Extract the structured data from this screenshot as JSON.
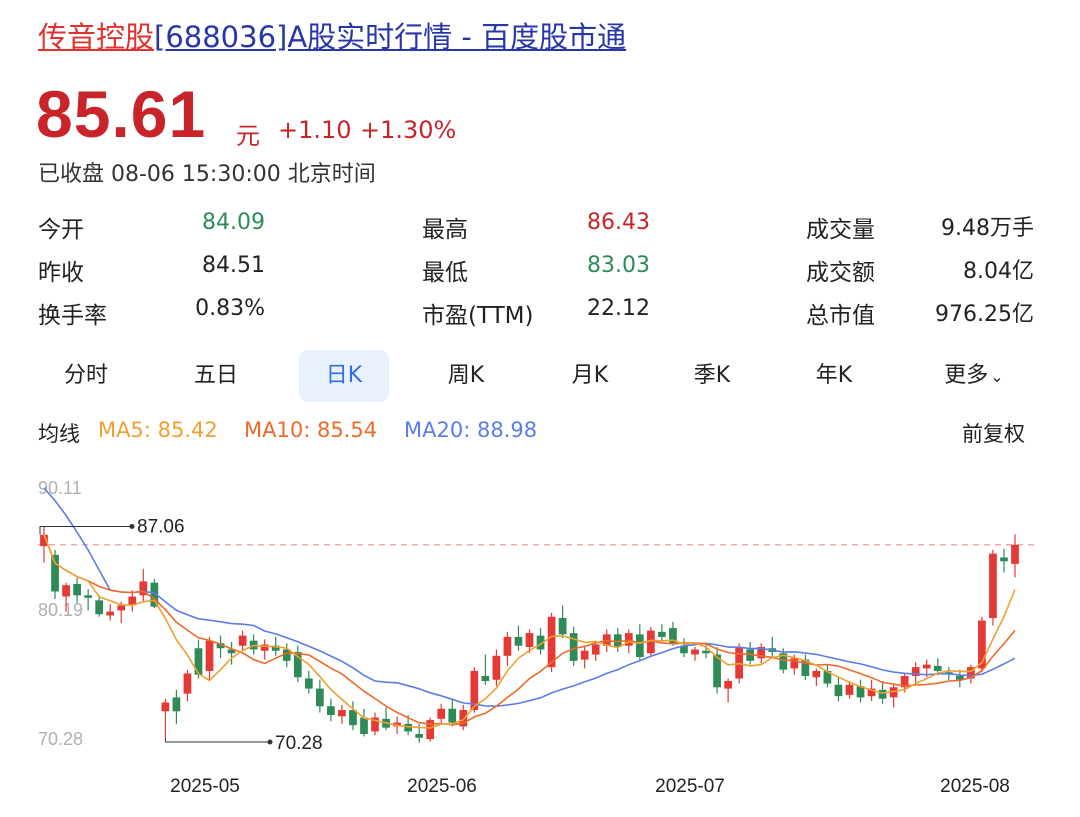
{
  "header": {
    "stock_name": "传音控股",
    "title_rest": "[688036]A股实时行情 - 百度股市通"
  },
  "quote": {
    "price": "85.61",
    "unit": "元",
    "change": "+1.10",
    "change_pct": "+1.30%",
    "status": "已收盘 08-06 15:30:00 北京时间"
  },
  "stats": [
    {
      "label": "今开",
      "value": "84.09",
      "color": "#2e8b57"
    },
    {
      "label": "昨收",
      "value": "84.51",
      "color": "#222222"
    },
    {
      "label": "换手率",
      "value": "0.83%",
      "color": "#222222"
    },
    {
      "label": "最高",
      "value": "86.43",
      "color": "#c8242a"
    },
    {
      "label": "最低",
      "value": "83.03",
      "color": "#2e8b57"
    },
    {
      "label": "市盈(TTM)",
      "value": "22.12",
      "color": "#222222"
    },
    {
      "label": "成交量",
      "value": "9.48万手",
      "color": "#222222"
    },
    {
      "label": "成交额",
      "value": "8.04亿",
      "color": "#222222"
    },
    {
      "label": "总市值",
      "value": "976.25亿",
      "color": "#222222"
    }
  ],
  "tabs": [
    "分时",
    "五日",
    "日K",
    "周K",
    "月K",
    "季K",
    "年K",
    "更多"
  ],
  "active_tab": "日K",
  "ma": {
    "label": "均线",
    "ma5": "MA5: 85.42",
    "ma10": "MA10: 85.54",
    "ma20": "MA20: 88.98",
    "adjust": "前复权",
    "colors": {
      "ma5": "#f0a030",
      "ma10": "#ee6a2a",
      "ma20": "#5b7de8"
    }
  },
  "chart_data": {
    "type": "candlestick",
    "y_ticks": [
      "90.11",
      "80.19",
      "70.28"
    ],
    "ylim": [
      70.28,
      90.11
    ],
    "x_ticks": [
      "2025-05",
      "2025-06",
      "2025-07",
      "2025-08"
    ],
    "annotations": {
      "high": "87.06",
      "low": "70.28"
    },
    "reference_price": 85.61,
    "colors": {
      "up": "#e53935",
      "down": "#2e8b57"
    },
    "candles": [
      [
        85.5,
        87.06,
        84.2,
        86.4
      ],
      [
        84.8,
        85.2,
        81.3,
        81.9
      ],
      [
        81.5,
        82.6,
        80.3,
        82.4
      ],
      [
        82.5,
        83.0,
        81.0,
        81.6
      ],
      [
        81.6,
        82.1,
        80.4,
        81.4
      ],
      [
        81.2,
        81.6,
        79.9,
        80.1
      ],
      [
        80.0,
        80.9,
        79.6,
        80.3
      ],
      [
        80.4,
        81.1,
        79.4,
        80.8
      ],
      [
        80.8,
        82.0,
        80.3,
        81.5
      ],
      [
        81.6,
        83.7,
        81.1,
        82.7
      ],
      [
        82.6,
        82.9,
        80.6,
        80.7
      ],
      [
        72.4,
        73.4,
        70.28,
        73.1
      ],
      [
        73.5,
        74.1,
        71.4,
        72.4
      ],
      [
        73.8,
        75.7,
        73.2,
        75.4
      ],
      [
        77.4,
        78.1,
        75.0,
        75.3
      ],
      [
        75.6,
        78.3,
        74.9,
        78.0
      ],
      [
        77.8,
        78.4,
        76.6,
        77.4
      ],
      [
        77.3,
        77.9,
        76.1,
        77.0
      ],
      [
        77.6,
        78.8,
        77.2,
        78.4
      ],
      [
        78.0,
        78.5,
        76.9,
        77.3
      ],
      [
        77.2,
        78.1,
        76.5,
        77.7
      ],
      [
        77.6,
        78.3,
        76.8,
        77.2
      ],
      [
        77.3,
        77.8,
        75.9,
        76.4
      ],
      [
        77.1,
        77.6,
        74.7,
        75.1
      ],
      [
        75.0,
        75.6,
        73.8,
        74.2
      ],
      [
        74.2,
        74.9,
        72.3,
        72.8
      ],
      [
        72.8,
        73.4,
        71.6,
        72.1
      ],
      [
        72.0,
        72.9,
        71.4,
        72.5
      ],
      [
        72.5,
        73.2,
        70.9,
        71.3
      ],
      [
        71.9,
        72.6,
        70.4,
        70.6
      ],
      [
        70.8,
        72.3,
        70.5,
        71.9
      ],
      [
        71.8,
        72.7,
        70.9,
        71.1
      ],
      [
        71.2,
        72.0,
        70.6,
        71.5
      ],
      [
        71.4,
        72.1,
        70.5,
        70.8
      ],
      [
        70.6,
        71.4,
        69.9,
        70.3
      ],
      [
        70.2,
        71.9,
        70.0,
        71.7
      ],
      [
        71.8,
        73.0,
        71.5,
        72.6
      ],
      [
        72.6,
        73.4,
        71.2,
        71.5
      ],
      [
        71.2,
        72.9,
        70.9,
        72.5
      ],
      [
        72.5,
        75.9,
        72.3,
        75.6
      ],
      [
        75.2,
        76.9,
        74.5,
        74.8
      ],
      [
        74.9,
        77.3,
        74.4,
        76.8
      ],
      [
        76.8,
        78.7,
        76.0,
        78.3
      ],
      [
        78.3,
        79.2,
        77.2,
        77.6
      ],
      [
        77.5,
        78.9,
        77.0,
        78.6
      ],
      [
        78.4,
        79.0,
        76.9,
        77.3
      ],
      [
        75.9,
        80.2,
        75.5,
        79.9
      ],
      [
        79.8,
        80.8,
        78.2,
        78.5
      ],
      [
        78.6,
        79.1,
        76.0,
        76.4
      ],
      [
        76.5,
        77.6,
        75.8,
        77.2
      ],
      [
        76.9,
        78.0,
        76.4,
        77.7
      ],
      [
        77.6,
        78.9,
        77.1,
        78.5
      ],
      [
        78.5,
        79.0,
        77.1,
        77.5
      ],
      [
        77.6,
        78.9,
        77.0,
        78.6
      ],
      [
        78.5,
        79.3,
        76.4,
        76.7
      ],
      [
        77.0,
        79.1,
        76.8,
        78.8
      ],
      [
        78.7,
        79.3,
        78.0,
        78.3
      ],
      [
        79.0,
        79.5,
        77.6,
        77.8
      ],
      [
        77.6,
        78.2,
        76.7,
        77.0
      ],
      [
        76.9,
        77.5,
        76.4,
        77.3
      ],
      [
        77.2,
        77.8,
        76.6,
        77.0
      ],
      [
        76.9,
        77.5,
        73.8,
        74.3
      ],
      [
        74.2,
        75.0,
        73.1,
        74.8
      ],
      [
        75.0,
        77.8,
        74.6,
        77.5
      ],
      [
        77.3,
        77.9,
        76.1,
        76.4
      ],
      [
        76.6,
        77.8,
        76.2,
        77.5
      ],
      [
        77.4,
        78.3,
        76.7,
        77.1
      ],
      [
        77.0,
        77.4,
        75.4,
        75.7
      ],
      [
        75.8,
        76.9,
        75.3,
        76.6
      ],
      [
        76.5,
        76.9,
        74.9,
        75.2
      ],
      [
        75.1,
        75.8,
        74.4,
        75.6
      ],
      [
        75.6,
        76.1,
        74.3,
        74.6
      ],
      [
        74.5,
        75.1,
        73.2,
        73.6
      ],
      [
        73.7,
        74.8,
        73.4,
        74.5
      ],
      [
        74.4,
        74.9,
        73.1,
        73.5
      ],
      [
        73.6,
        74.9,
        73.2,
        74.2
      ],
      [
        74.1,
        74.8,
        73.0,
        73.4
      ],
      [
        73.5,
        74.5,
        72.7,
        74.3
      ],
      [
        74.3,
        75.4,
        73.9,
        75.2
      ],
      [
        75.2,
        76.3,
        74.6,
        75.9
      ],
      [
        75.8,
        76.5,
        75.1,
        76.1
      ],
      [
        76.0,
        76.6,
        75.3,
        75.6
      ],
      [
        75.5,
        75.9,
        74.9,
        75.3
      ],
      [
        75.2,
        75.7,
        74.3,
        74.9
      ],
      [
        75.0,
        76.1,
        74.6,
        75.9
      ],
      [
        75.8,
        79.9,
        75.5,
        79.6
      ],
      [
        79.8,
        85.2,
        79.2,
        84.9
      ],
      [
        84.6,
        85.3,
        83.4,
        84.3
      ],
      [
        84.09,
        86.43,
        83.03,
        85.61
      ]
    ]
  }
}
